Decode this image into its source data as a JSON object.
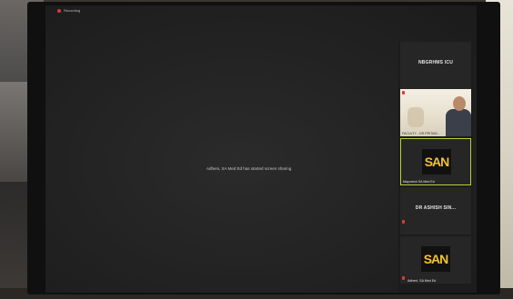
{
  "recording": {
    "label": "Recording"
  },
  "notice": {
    "text": "Adheni, SA Med Ed has started screen sharing"
  },
  "gallery": {
    "tiles": [
      {
        "type": "name",
        "name": "NBGRHMS ICU"
      },
      {
        "type": "video",
        "caption": "FACULTY - DR PRITAM..."
      },
      {
        "type": "logo",
        "logo": "SAN",
        "caption": "Mayuresh SA Med Ed"
      },
      {
        "type": "name",
        "name": "DR ASHISH SIN..."
      },
      {
        "type": "logo",
        "logo": "SAN",
        "caption": "Adheni, SA Med Ed"
      }
    ]
  },
  "colors": {
    "active_border": "#b5d33a",
    "logo": "#f2c230",
    "recording_dot": "#e03a2f"
  }
}
